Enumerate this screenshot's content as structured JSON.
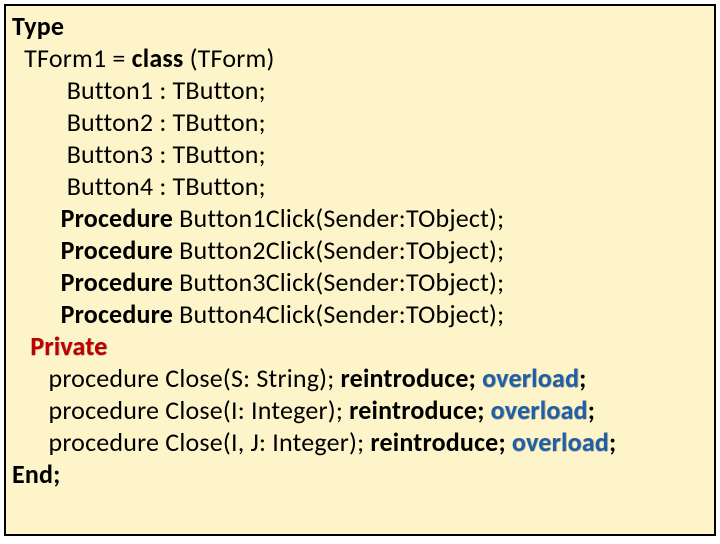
{
  "code": {
    "l1": {
      "kw1": "Type"
    },
    "l2": {
      "pre": "  TForm1 = ",
      "kw": "class",
      "post": " (TForm)"
    },
    "l3": {
      "text": "         Button1 : TButton;"
    },
    "l4": {
      "text": "         Button2 : TButton;"
    },
    "l5": {
      "text": "         Button3 : TButton;"
    },
    "l6": {
      "text": "         Button4 : TButton;"
    },
    "l7": {
      "pre": "        ",
      "kw": "Procedure",
      "post": " Button1Click(Sender:TObject);"
    },
    "l8": {
      "pre": "        ",
      "kw": "Procedure",
      "post": " Button2Click(Sender:TObject);"
    },
    "l9": {
      "pre": "        ",
      "kw": "Procedure",
      "post": " Button3Click(Sender:TObject);"
    },
    "l10": {
      "pre": "        ",
      "kw": "Procedure",
      "post": " Button4Click(Sender:TObject);"
    },
    "l11": {
      "pre": "   ",
      "kw": "Private"
    },
    "l12": {
      "pre": "      procedure Close(S: String); ",
      "reintro": "reintroduce;",
      "sp": " ",
      "ov": "overload",
      "semi": ";"
    },
    "l13": {
      "pre": "      procedure Close(I: Integer); ",
      "reintro": "reintroduce;",
      "sp": " ",
      "ov": "overload",
      "semi": ";"
    },
    "l14": {
      "pre": "      procedure Close(I, J: Integer); ",
      "reintro": "reintroduce;",
      "sp": " ",
      "ov": "overload",
      "semi": ";"
    },
    "l15": {
      "kw": "End;"
    }
  }
}
